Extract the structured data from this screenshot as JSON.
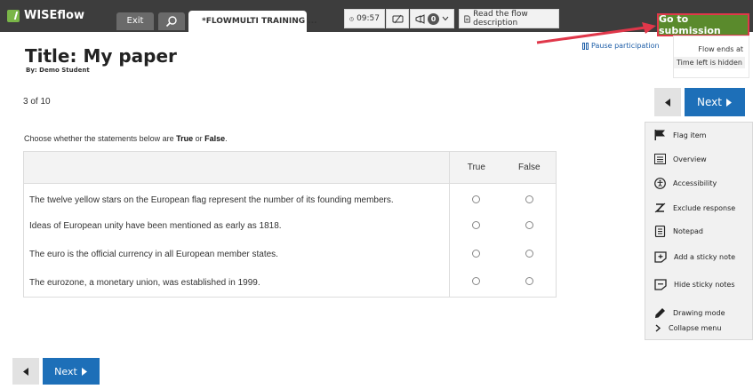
{
  "topbar": {
    "brand": "WISEflow",
    "exit_label": "Exit",
    "flow_tab_label": "*FLOWMULTI TRAINING ...",
    "timer": "09:57",
    "announcement_count": "0",
    "read_description": "Read the flow description",
    "submit_label": "Go to submission"
  },
  "header": {
    "title": "Title: My paper",
    "author": "By: Demo Student",
    "pause_label": "Pause participation",
    "flow_ends_label": "Flow ends at",
    "time_left_label": "Time left is hidden"
  },
  "question": {
    "counter": "3 of 10",
    "instruction_prefix": "Choose whether the statements below are ",
    "instruction_true": "True",
    "instruction_mid": " or ",
    "instruction_false": "False",
    "instruction_suffix": ".",
    "columns": [
      "True",
      "False"
    ],
    "statements": [
      "The twelve yellow stars on the European flag represent the number of its founding members.",
      "Ideas of European unity have been mentioned as early as 1818.",
      "The euro is the official currency in all European member states.",
      "The eurozone, a monetary union, was established in 1999."
    ]
  },
  "navigation": {
    "next_label": "Next"
  },
  "side_menu": {
    "items": [
      {
        "label": "Flag item",
        "icon": "flag-icon"
      },
      {
        "label": "Overview",
        "icon": "list-icon"
      },
      {
        "label": "Accessibility",
        "icon": "accessibility-icon"
      },
      {
        "label": "Exclude response",
        "icon": "exclude-icon"
      },
      {
        "label": "Notepad",
        "icon": "notepad-icon"
      },
      {
        "label": "Add a sticky note",
        "icon": "sticky-note-add-icon"
      },
      {
        "label": "Hide sticky notes",
        "icon": "sticky-note-hide-icon"
      },
      {
        "label": "Drawing mode",
        "icon": "pencil-icon"
      },
      {
        "label": "Collapse menu",
        "icon": "chevron-right-icon"
      }
    ]
  },
  "colors": {
    "topbar": "#3d3d3d",
    "brand_green": "#7ab648",
    "submit_green": "#5a8a2c",
    "annotation_red": "#e0374a",
    "primary_blue": "#1d6fb8"
  }
}
